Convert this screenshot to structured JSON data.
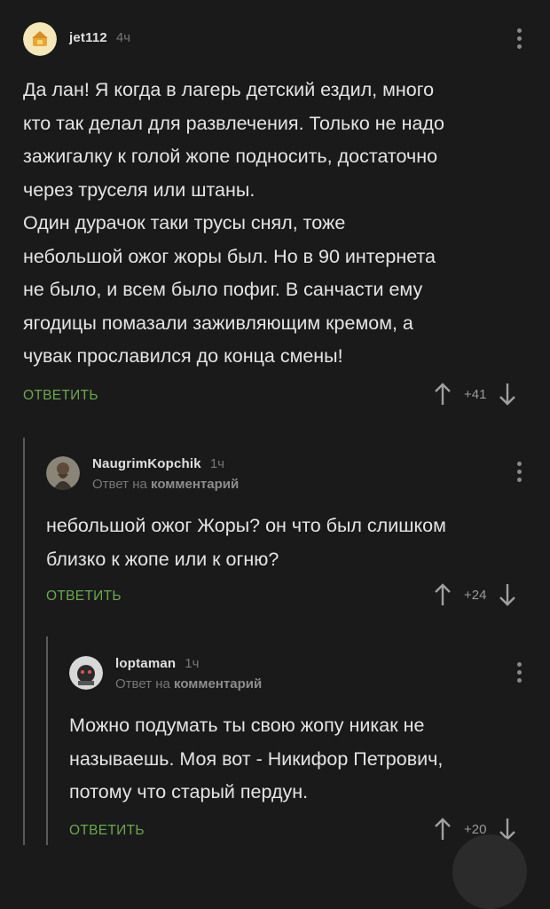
{
  "comments": [
    {
      "username": "jet112",
      "time": "4ч",
      "text": "Да лан! Я когда в лагерь детский ездил, много\nкто так делал для развлечения. Только не надо\nзажигалку к голой жопе подносить, достаточно\nчерез труселя или штаны.\nОдин дурачок таки трусы снял, тоже\nнебольшой ожог жоры был. Но в 90 интернета\nне было, и всем было пофиг. В санчасти ему\nягодицы помазали заживляющим кремом, а\nчувак прославился до конца смены!",
      "reply_label": "ОТВЕТИТЬ",
      "rating": "+41"
    },
    {
      "username": "NaugrimKopchik",
      "time": "1ч",
      "reply_prefix": "Ответ на",
      "reply_target": "комментарий",
      "text": "небольшой ожог Жоры? он что был слишком\nблизко к жопе или к огню?",
      "reply_label": "ОТВЕТИТЬ",
      "rating": "+24"
    },
    {
      "username": "loptaman",
      "time": "1ч",
      "reply_prefix": "Ответ на",
      "reply_target": "комментарий",
      "text": "Можно подумать ты свою жопу никак не\nназываешь. Моя вот - Никифор Петрович,\nпотому что старый пердун.",
      "reply_label": "ОТВЕТИТЬ",
      "rating": "+20"
    }
  ],
  "colors": {
    "background": "#1a1a1a",
    "reply_green": "#6aa84f",
    "muted": "#777777"
  },
  "icons": {
    "upvote": "arrow-up-icon",
    "downvote": "arrow-down-icon",
    "more": "kebab-menu-icon"
  }
}
